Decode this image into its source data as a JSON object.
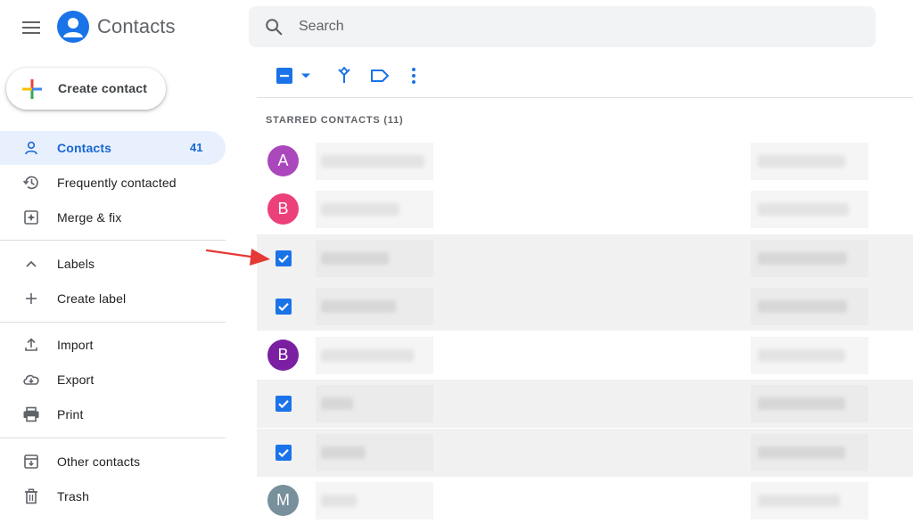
{
  "app": {
    "title": "Contacts"
  },
  "search": {
    "placeholder": "Search"
  },
  "create": {
    "label": "Create contact"
  },
  "sidebar": {
    "items": [
      {
        "label": "Contacts",
        "count": "41",
        "icon": "person-icon",
        "active": true
      },
      {
        "label": "Frequently contacted",
        "icon": "history-icon"
      },
      {
        "label": "Merge & fix",
        "icon": "merge-fix-icon"
      },
      {
        "label": "Labels",
        "icon": "chevron-up-icon"
      },
      {
        "label": "Create label",
        "icon": "plus-icon"
      },
      {
        "label": "Import",
        "icon": "upload-icon"
      },
      {
        "label": "Export",
        "icon": "cloud-download-icon"
      },
      {
        "label": "Print",
        "icon": "printer-icon"
      },
      {
        "label": "Other contacts",
        "icon": "archive-icon"
      },
      {
        "label": "Trash",
        "icon": "trash-icon"
      }
    ]
  },
  "toolbar": {
    "icons": [
      "select-partial-checkbox-icon",
      "dropdown-arrow-icon",
      "merge-icon",
      "label-icon",
      "more-vert-icon"
    ]
  },
  "list": {
    "section_title": "STARRED CONTACTS (11)",
    "rows": [
      {
        "type": "avatar",
        "letter": "A",
        "color": "#ab47bc"
      },
      {
        "type": "avatar",
        "letter": "B",
        "color": "#ec407a"
      },
      {
        "type": "checkbox",
        "checked": true
      },
      {
        "type": "checkbox",
        "checked": true
      },
      {
        "type": "avatar",
        "letter": "B",
        "color": "#7b1fa2"
      },
      {
        "type": "checkbox",
        "checked": true
      },
      {
        "type": "checkbox",
        "checked": true
      },
      {
        "type": "avatar",
        "letter": "M",
        "color": "#78909c"
      }
    ]
  },
  "colors": {
    "accent": "#1a73e8",
    "active_bg": "#e8f0fe",
    "annotation_arrow": "#e53935"
  }
}
